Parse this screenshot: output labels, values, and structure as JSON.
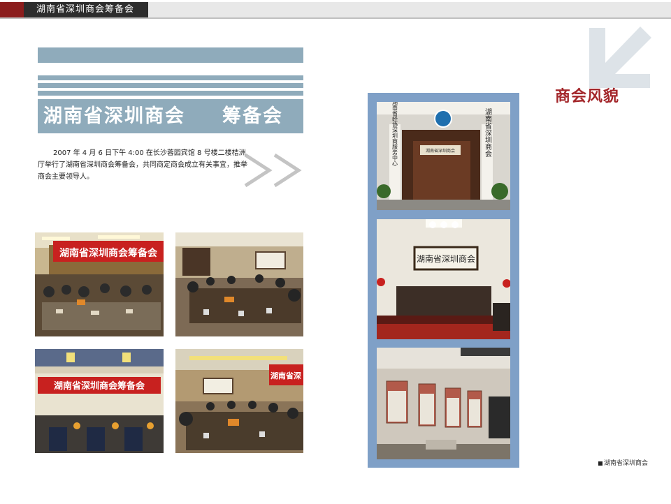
{
  "header": {
    "title": "湖南省深圳商会筹备会"
  },
  "title": {
    "main": "湖南省深圳商会",
    "sub": "筹备会"
  },
  "intro_text": "2007 年 4 月 6 日下午 4:00 在长沙蓉园宾馆 8 号楼二楼桔洲厅举行了湖南省深圳商会筹备会，共同商定商会成立有关事宜，推举商会主要领导人。",
  "section_title": "商会风貌",
  "photos": {
    "banner_text": "湖南省深圳商会筹备会",
    "plaque_side_left": "湖南省经协深圳商服务中心",
    "plaque_side_right": "湖南省深圳商会",
    "plaque_door": "湖南省深圳商会",
    "plaque_reception": "湖南省深圳商会"
  },
  "footer": {
    "text": "湖南省深圳商会"
  },
  "colors": {
    "accent_red": "#a3262a",
    "stripe_blue": "#8fabbb",
    "panel_blue": "#7fa0c7",
    "header_dark": "#2d2d2d"
  }
}
